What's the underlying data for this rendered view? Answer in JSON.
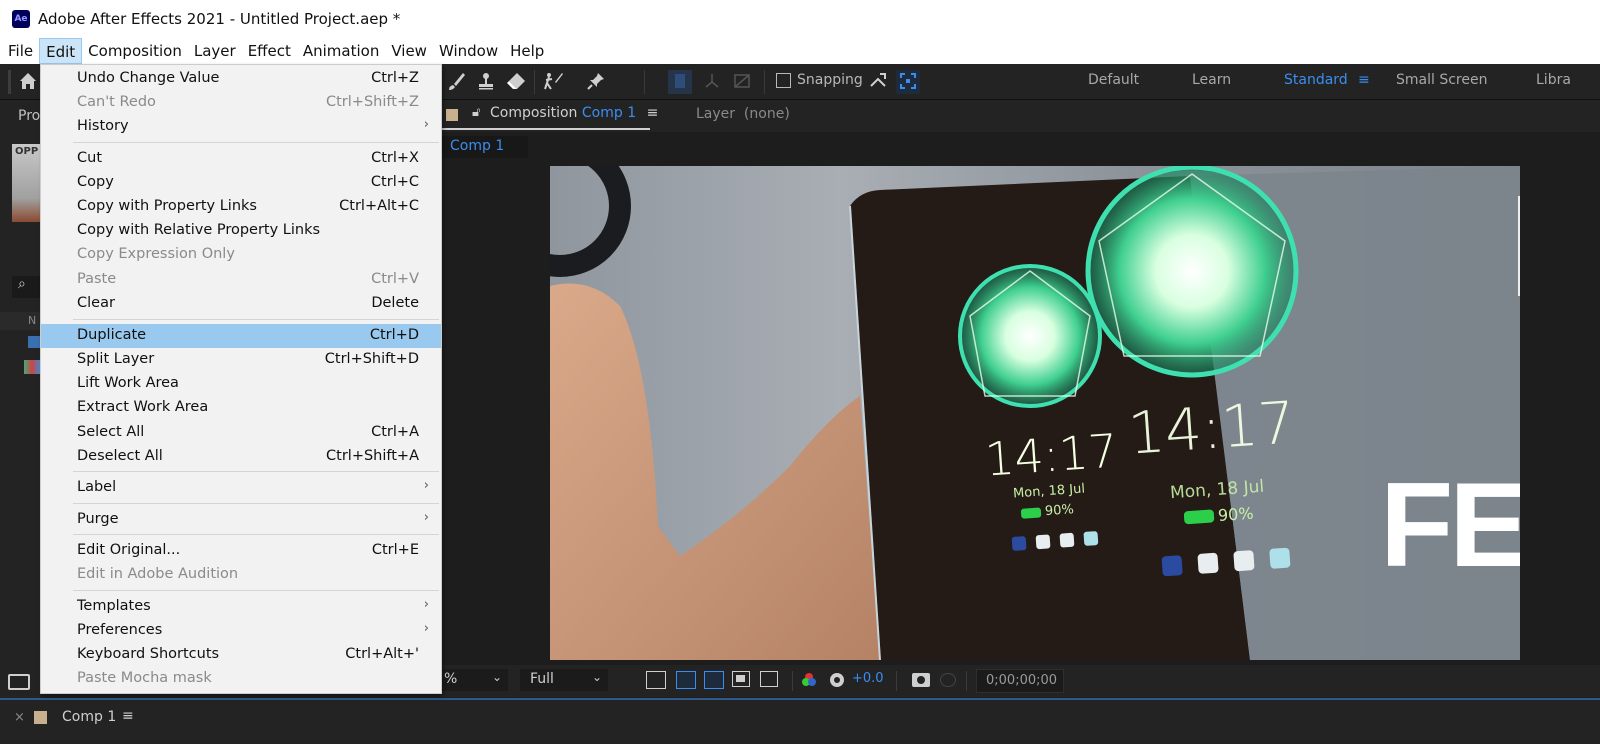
{
  "window": {
    "app_icon": "Ae",
    "title": "Adobe After Effects 2021 - Untitled Project.aep *"
  },
  "menubar": {
    "items": [
      "File",
      "Edit",
      "Composition",
      "Layer",
      "Effect",
      "Animation",
      "View",
      "Window",
      "Help"
    ],
    "active": "Edit"
  },
  "toolbar": {
    "snapping_label": "Snapping",
    "snapping_checked": false,
    "workspaces": [
      {
        "label": "Default",
        "active": false
      },
      {
        "label": "Learn",
        "active": false
      },
      {
        "label": "Standard",
        "active": true
      },
      {
        "label": "Small Screen",
        "active": false
      },
      {
        "label": "Libra",
        "active": false
      }
    ],
    "icons": [
      "home-icon",
      "brush-icon",
      "clone-stamp-icon",
      "eraser-icon",
      "roto-brush-icon",
      "puppet-pin-icon",
      "snap-icon",
      "snap-feather-icon"
    ]
  },
  "left_panel": {
    "tab_label": "Pro",
    "thumbnail_label": "OPP",
    "column_label": "N"
  },
  "comp_panel": {
    "tab_prefix": "Composition",
    "tab_name": "Comp 1",
    "layer_tab": "Layer  (none)",
    "breadcrumb": "Comp 1"
  },
  "preview": {
    "phone_time": "14:17",
    "phone_date": "Mon, 18 Jul",
    "phone_battery": "90%",
    "reflection_time": "14:17",
    "reflection_date": "Mon, 18 Jul",
    "reflection_battery": "90%",
    "overlay_text": "FE"
  },
  "viewer_bar": {
    "zoom_value": "%",
    "resolution": "Full",
    "exposure": "+0.0",
    "timecode": "0;00;00;00"
  },
  "timeline": {
    "tab_label": "Comp 1",
    "close_glyph": "×",
    "menu_glyph": "≡"
  },
  "edit_menu": {
    "items": [
      {
        "label": "Undo Change Value",
        "shortcut": "Ctrl+Z",
        "disabled": false
      },
      {
        "label": "Can't Redo",
        "shortcut": "Ctrl+Shift+Z",
        "disabled": true
      },
      {
        "label": "History",
        "submenu": true,
        "disabled": false
      },
      {
        "separator": true
      },
      {
        "label": "Cut",
        "shortcut": "Ctrl+X",
        "disabled": false
      },
      {
        "label": "Copy",
        "shortcut": "Ctrl+C",
        "disabled": false
      },
      {
        "label": "Copy with Property Links",
        "shortcut": "Ctrl+Alt+C",
        "disabled": false
      },
      {
        "label": "Copy with Relative Property Links",
        "disabled": false
      },
      {
        "label": "Copy Expression Only",
        "disabled": true
      },
      {
        "label": "Paste",
        "shortcut": "Ctrl+V",
        "disabled": true
      },
      {
        "label": "Clear",
        "shortcut": "Delete",
        "disabled": false
      },
      {
        "separator": true
      },
      {
        "label": "Duplicate",
        "shortcut": "Ctrl+D",
        "disabled": false,
        "highlighted": true
      },
      {
        "label": "Split Layer",
        "shortcut": "Ctrl+Shift+D",
        "disabled": false
      },
      {
        "label": "Lift Work Area",
        "disabled": false
      },
      {
        "label": "Extract Work Area",
        "disabled": false
      },
      {
        "label": "Select All",
        "shortcut": "Ctrl+A",
        "disabled": false
      },
      {
        "label": "Deselect All",
        "shortcut": "Ctrl+Shift+A",
        "disabled": false
      },
      {
        "separator": true
      },
      {
        "label": "Label",
        "submenu": true,
        "disabled": false
      },
      {
        "separator": true
      },
      {
        "label": "Purge",
        "submenu": true,
        "disabled": false
      },
      {
        "separator": true
      },
      {
        "label": "Edit Original...",
        "shortcut": "Ctrl+E",
        "disabled": false
      },
      {
        "label": "Edit in Adobe Audition",
        "disabled": true
      },
      {
        "separator": true
      },
      {
        "label": "Templates",
        "submenu": true,
        "disabled": false
      },
      {
        "label": "Preferences",
        "submenu": true,
        "disabled": false
      },
      {
        "label": "Keyboard Shortcuts",
        "shortcut": "Ctrl+Alt+'",
        "disabled": false
      },
      {
        "label": "Paste Mocha mask",
        "disabled": true
      }
    ]
  },
  "colors": {
    "accent_blue": "#3a8eef",
    "menu_highlight": "#99c9ef",
    "panel_bg": "#232323",
    "menu_bg": "#f2f2f2"
  }
}
